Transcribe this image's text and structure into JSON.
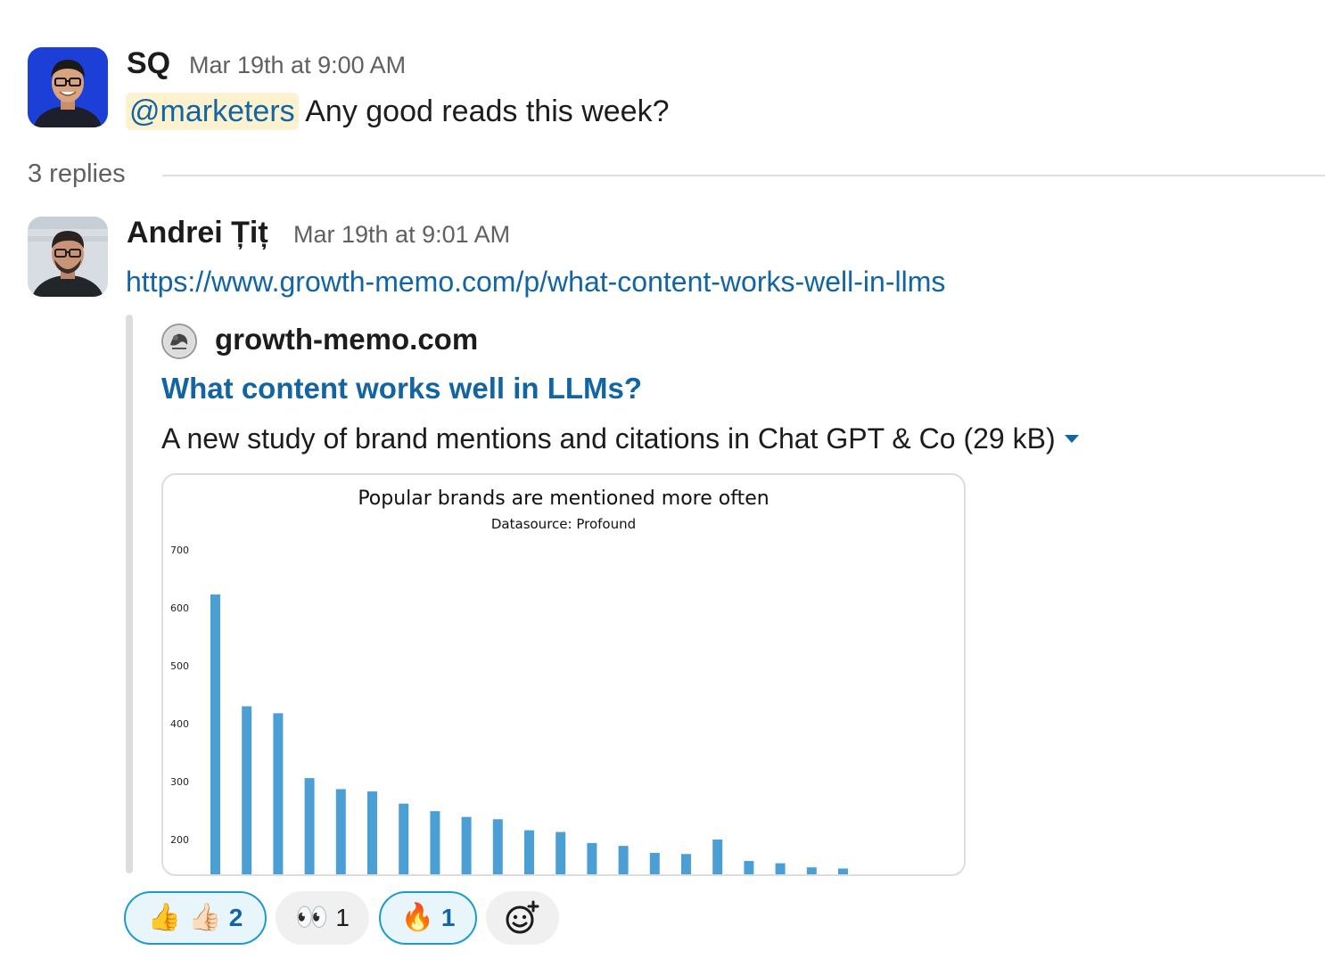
{
  "messages": [
    {
      "author": "SQ",
      "timestamp": "Mar 19th at 9:00 AM",
      "mention": "@marketers",
      "text": " Any good reads this week?"
    },
    {
      "author": "Andrei Țiț",
      "timestamp": "Mar 19th at 9:01 AM",
      "link": "https://www.growth-memo.com/p/what-content-works-well-in-llms"
    }
  ],
  "thread": {
    "replies_label": "3 replies"
  },
  "unfurl": {
    "site": "growth-memo.com",
    "title": "What content works well in LLMs?",
    "description": "A new study of brand mentions and citations in Chat GPT & Co (29 kB)"
  },
  "chart_data": {
    "type": "bar",
    "title": "Popular brands are mentioned more often",
    "subtitle": "Datasource: Profound",
    "xlabel": "",
    "ylabel": "",
    "ylim": [
      140,
      700
    ],
    "yticks": [
      "200",
      "300",
      "400",
      "500",
      "600",
      "700"
    ],
    "values": [
      623,
      430,
      418,
      306,
      287,
      283,
      262,
      249,
      239,
      235,
      216,
      213,
      194,
      189,
      177,
      175,
      200,
      163,
      159,
      152,
      150
    ],
    "bar_color": "#4c9fd5",
    "grid": false
  },
  "reactions": [
    {
      "emoji": "👍 👍🏻",
      "count": "2",
      "active": true
    },
    {
      "emoji": "👀",
      "count": "1",
      "active": false
    },
    {
      "emoji": "🔥",
      "count": "1",
      "active": true
    }
  ],
  "colors": {
    "link": "#1264a3",
    "mention_bg": "#fdf2d0",
    "reaction_active_border": "#1d9bd1"
  },
  "icons": {
    "add_reaction": "add-reaction-icon"
  }
}
